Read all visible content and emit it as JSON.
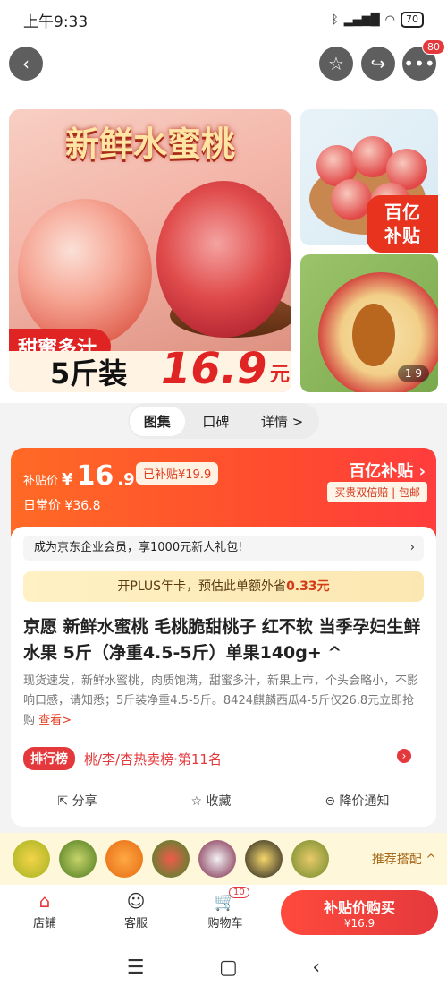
{
  "status_bar": {
    "time": "上午9:33",
    "battery": "70"
  },
  "header": {
    "more_badge": "80"
  },
  "gallery": {
    "main_title": "新鲜水蜜桃",
    "sweet_label": "甜蜜多汁",
    "pack_label": "5斤装",
    "pack_price": "16.9",
    "pack_unit": "元",
    "corner_line1": "百亿",
    "corner_line2": "补贴",
    "counter": "1   9"
  },
  "tabs": [
    "图集",
    "口碑",
    "详情 >"
  ],
  "price": {
    "label": "补贴价",
    "currency": "¥",
    "integer": "16",
    "decimal": ".9",
    "already": "已补贴¥19.9",
    "daily": "日常价 ¥36.8",
    "yi_subsidy": "百亿补贴 ›",
    "guarantee": "买贵双倍赔 | 包邮"
  },
  "member": {
    "text": "成为京东企业会员，享1000元新人礼包!",
    "arrow": "›"
  },
  "plus": {
    "prefix": "开PLUS年卡，预估此单额外省",
    "amount": "0.33元"
  },
  "product": {
    "title": "京愿 新鲜水蜜桃 毛桃脆甜桃子 红不软 当季孕妇生鲜水果 5斤（净重4.5-5斤）单果140g+ ^",
    "desc": "现货速发，新鲜水蜜桃，肉质饱满，甜蜜多汁，新果上市，个头会略小，不影响口感，请知悉；5斤装净重4.5-5斤。8424麒麟西瓜4-5斤仅26.8元立即抢购 ",
    "more": "查看>"
  },
  "rank": {
    "badge": "排行榜",
    "text": "桃/李/杏热卖榜·第11名"
  },
  "actions": {
    "share": "分享",
    "favorite": "收藏",
    "price_alert": "降价通知"
  },
  "reco": {
    "label": "推荐搭配 ^"
  },
  "bottom": {
    "shop": "店铺",
    "service": "客服",
    "cart": "购物车",
    "cart_badge": "10",
    "buy_line1": "补贴价购买",
    "buy_line2": "¥16.9"
  }
}
